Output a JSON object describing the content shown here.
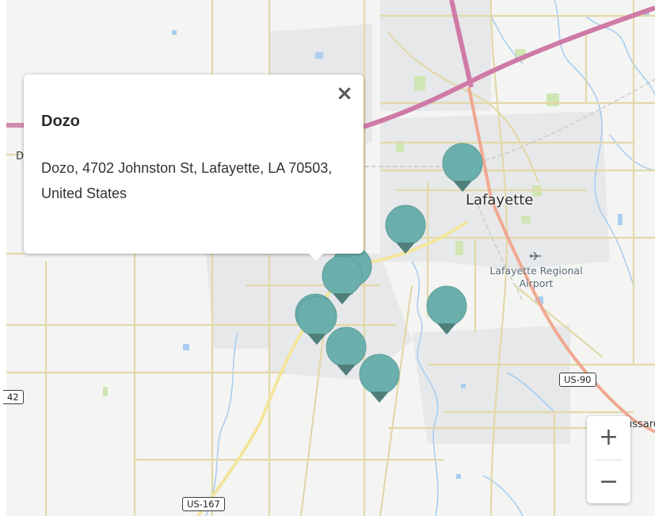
{
  "map": {
    "city_label": "Lafayette",
    "airport_label_line1": "Lafayette Regional",
    "airport_label_line2": "Airport",
    "partial_labels": {
      "left_d": "D",
      "broussard": "ussard"
    },
    "shields": {
      "us90": "US-90",
      "us167": "US-167",
      "la342": "42"
    },
    "marker_color": "#6aafab",
    "markers": [
      {
        "name": "marker-1"
      },
      {
        "name": "marker-2"
      },
      {
        "name": "marker-3"
      },
      {
        "name": "marker-4"
      },
      {
        "name": "marker-5"
      },
      {
        "name": "marker-6"
      },
      {
        "name": "marker-7"
      },
      {
        "name": "marker-8"
      },
      {
        "name": "marker-9"
      }
    ]
  },
  "popup": {
    "title": "Dozo",
    "address": "Dozo, 4702 Johnston St, Lafayette, LA 70503, United States",
    "close_icon": "×"
  },
  "zoom": {
    "in_label": "+",
    "out_label": "−"
  }
}
